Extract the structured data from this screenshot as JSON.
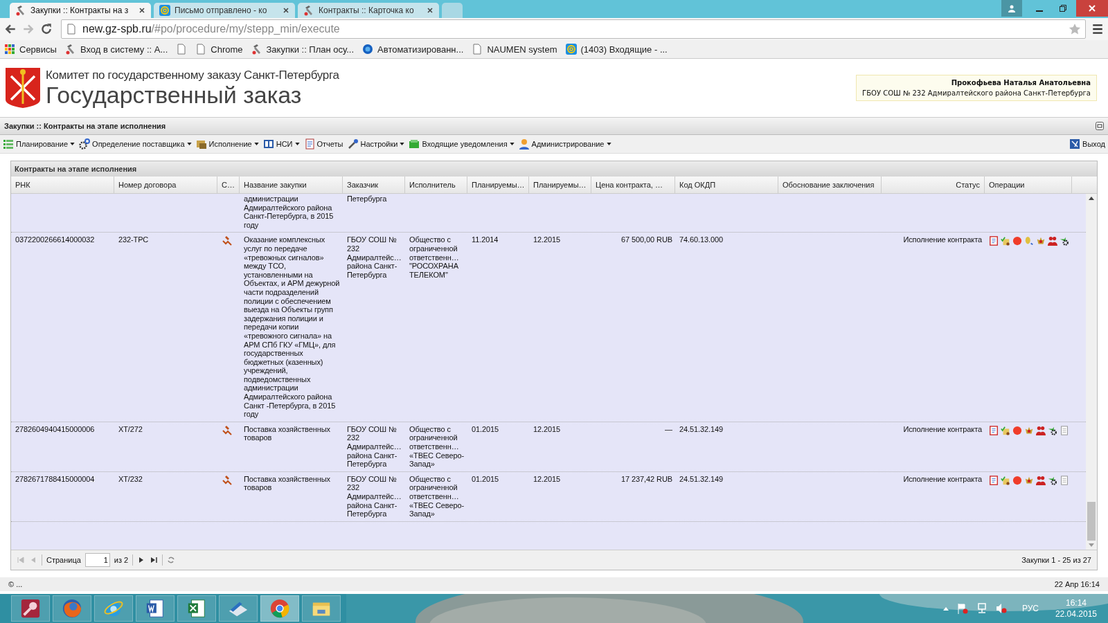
{
  "browser": {
    "tabs": [
      {
        "title": "Закупки :: Контракты на з",
        "kind": "hammer",
        "selected": true
      },
      {
        "title": "Письмо отправлено - ко",
        "kind": "mail",
        "selected": false
      },
      {
        "title": "Контракты :: Карточка ко",
        "kind": "hammer",
        "selected": false
      }
    ],
    "url": {
      "host": "new.gz-spb.ru",
      "path": "/#po/procedure/my/stepp_min/execute"
    },
    "bookmarks": [
      {
        "label": "Сервисы",
        "kind": "apps"
      },
      {
        "label": "Вход в систему :: А...",
        "kind": "hammer"
      },
      {
        "kind": "page"
      },
      {
        "label": "Chrome",
        "kind": "page"
      },
      {
        "label": "Закупки :: План осу...",
        "kind": "hammer"
      },
      {
        "label": "Автоматизированн...",
        "kind": "globe"
      },
      {
        "label": "NAUMEN system",
        "kind": "page"
      },
      {
        "label": "(1403) Входящие - ...",
        "kind": "mail"
      }
    ]
  },
  "header": {
    "subtitle": "Комитет по государственному заказу Санкт-Петербурга",
    "title": "Государственный заказ",
    "user": {
      "name": "Прокофьева Наталья Анатольевна",
      "org": "ГБОУ СОШ № 232 Адмиралтейского района Санкт-Петербурга"
    }
  },
  "app_title": "Закупки :: Контракты на этапе исполнения",
  "menu": [
    {
      "label": "Планирование",
      "kind": "list",
      "dropdown": true
    },
    {
      "label": "Определение поставщика",
      "kind": "gears",
      "dropdown": true
    },
    {
      "label": "Исполнение",
      "kind": "folder",
      "dropdown": true
    },
    {
      "label": "НСИ",
      "kind": "book",
      "dropdown": true
    },
    {
      "label": "Отчеты",
      "kind": "report",
      "dropdown": false
    },
    {
      "label": "Настройки",
      "kind": "wrench",
      "dropdown": true
    },
    {
      "label": "Входящие уведомления",
      "kind": "inbox",
      "dropdown": true
    },
    {
      "label": "Администрирование",
      "kind": "person",
      "dropdown": true
    }
  ],
  "logout": "Выход",
  "grid": {
    "title": "Контракты на этапе исполнения",
    "columns": [
      "РНК",
      "Номер договора",
      "С…",
      "Название закупки",
      "Заказчик",
      "Исполнитель",
      "Планируемы…",
      "Планируемы…",
      "Цена контракта, …",
      "Код ОКДП",
      "Обоснование заключения",
      "Статус",
      "Операции"
    ],
    "rows": [
      {
        "kind": "partial",
        "name": "администрации Адмиралтейского района Санкт-Петербурга, в 2015 году",
        "customer": "Петербурга"
      },
      {
        "kind": "full",
        "rnk": "0372200266614000032",
        "contract_no": "232-ТРС",
        "name": "Оказание комплексных услуг по передаче «тревожных сигналов» между ТСО, установленными на Объектах, и АРМ дежурной части подразделений полиции с обеспечением выезда на Объекты групп задержания полиции и передачи копии «тревожного сигнала» на АРМ СПб ГКУ «ГМЦ», для государственных бюджетных (казенных) учреждений, подведомственных администрации Адмиралтейского района Санкт -Петербурга, в 2015 году",
        "customer": "ГБОУ СОШ № 232 Адмиралтейс… района Санкт-Петербурга",
        "executor": "Общество с ограниченной ответственн… \"РОСОХРАНА ТЕЛЕКОМ\"",
        "plan_start": "11.2014",
        "plan_end": "12.2015",
        "price": "67 500,00 RUB",
        "okpd": "74.60.13.000",
        "status": "Исполнение контракта",
        "ops": [
          {
            "kind": "journal"
          },
          {
            "kind": "approve"
          },
          {
            "kind": "stop"
          },
          {
            "kind": "coins"
          },
          {
            "kind": "emblem"
          },
          {
            "kind": "users"
          },
          {
            "kind": "settings"
          }
        ]
      },
      {
        "kind": "full",
        "rnk": "2782604940415000006",
        "contract_no": "ХТ/272",
        "name": "Поставка хозяйственных товаров",
        "customer": "ГБОУ СОШ № 232 Адмиралтейс… района Санкт-Петербурга",
        "executor": "Общество с ограниченной ответственн… «ТВЕС Северо-Запад»",
        "plan_start": "01.2015",
        "plan_end": "12.2015",
        "price": "—",
        "okpd": "24.51.32.149",
        "status": "Исполнение контракта",
        "ops": [
          {
            "kind": "journal"
          },
          {
            "kind": "approve"
          },
          {
            "kind": "stop"
          },
          {
            "kind": "emblem"
          },
          {
            "kind": "users"
          },
          {
            "kind": "settings"
          },
          {
            "kind": "document"
          }
        ]
      },
      {
        "kind": "full",
        "rnk": "2782671788415000004",
        "contract_no": "ХТ/232",
        "name": "Поставка хозяйственных товаров",
        "customer": "ГБОУ СОШ № 232 Адмиралтейс… района Санкт-Петербурга",
        "executor": "Общество с ограниченной ответственн… «ТВЕС Северо-Запад»",
        "plan_start": "01.2015",
        "plan_end": "12.2015",
        "price": "17 237,42 RUB",
        "okpd": "24.51.32.149",
        "status": "Исполнение контракта",
        "ops": [
          {
            "kind": "journal"
          },
          {
            "kind": "approve"
          },
          {
            "kind": "stop"
          },
          {
            "kind": "emblem"
          },
          {
            "kind": "users"
          },
          {
            "kind": "settings"
          },
          {
            "kind": "document"
          }
        ]
      }
    ],
    "pager": {
      "page_label": "Страница",
      "page": "1",
      "of": "из 2",
      "summary": "Закупки 1 - 25 из 27"
    }
  },
  "footer": {
    "left": "© ...",
    "right": "22 Апр 16:14"
  },
  "taskbar": {
    "apps": [
      {
        "kind": "key",
        "selected": false
      },
      {
        "kind": "firefox",
        "selected": false
      },
      {
        "kind": "ie",
        "selected": false
      },
      {
        "kind": "word",
        "selected": false
      },
      {
        "kind": "excel",
        "selected": false
      },
      {
        "kind": "scanner",
        "selected": false
      },
      {
        "kind": "chrome",
        "selected": true
      },
      {
        "kind": "folder",
        "selected": false
      }
    ],
    "lang": "РУС",
    "time": "16:14",
    "date": "22.04.2015"
  }
}
